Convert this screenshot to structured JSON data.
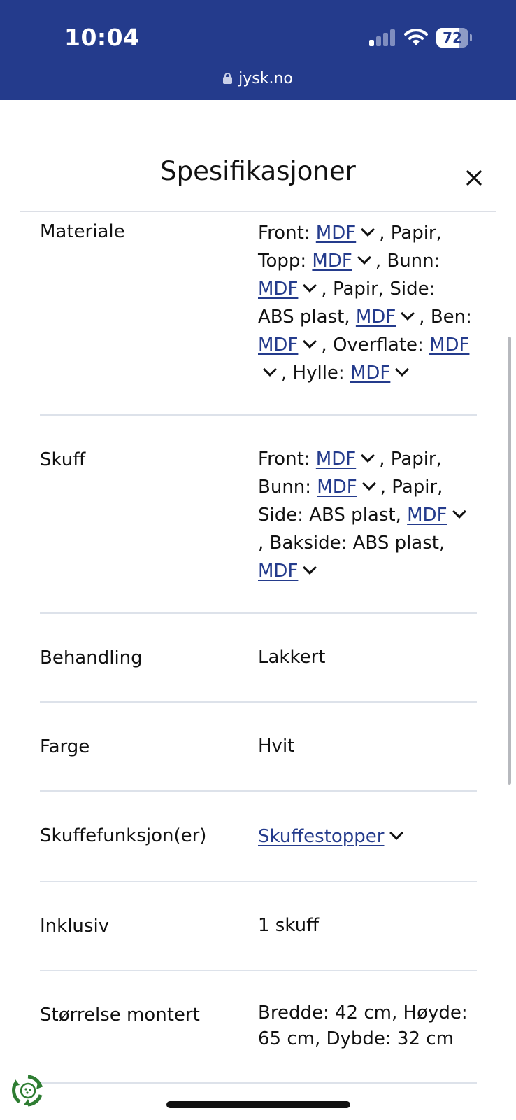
{
  "status_bar": {
    "time": "10:04",
    "battery": "72",
    "battery_level": 0.72,
    "url": "jysk.no"
  },
  "sheet": {
    "title": "Spesifikasjoner"
  },
  "rows": [
    {
      "label": "Materiale",
      "value": [
        "Front: ",
        {
          "link": "MDF"
        },
        ", Papir, Topp: ",
        {
          "link": "MDF"
        },
        ", Bunn: ",
        {
          "link": "MDF"
        },
        ", Papir, Side: ABS plast, ",
        {
          "link": "MDF"
        },
        ", Ben: ",
        {
          "link": "MDF"
        },
        ", Overflate: ",
        {
          "link": "MDF"
        },
        ", Hylle: ",
        {
          "link": "MDF"
        }
      ]
    },
    {
      "label": "Skuff",
      "value": [
        "Front: ",
        {
          "link": "MDF"
        },
        ", Papir, Bunn: ",
        {
          "link": "MDF"
        },
        ", Papir, Side: ABS plast, ",
        {
          "link": "MDF"
        },
        ", Bakside: ABS plast, ",
        {
          "link": "MDF"
        }
      ]
    },
    {
      "label": "Behandling",
      "value": [
        "Lakkert"
      ]
    },
    {
      "label": "Farge",
      "value": [
        "Hvit"
      ]
    },
    {
      "label": "Skuffefunksjon(er)",
      "value": [
        {
          "link": "Skuffestopper"
        }
      ]
    },
    {
      "label": "Inklusiv",
      "value": [
        "1 skuff"
      ]
    },
    {
      "label": "Størrelse montert",
      "value": [
        "Bredde: 42 cm, Høyde: 65 cm, Dybde: 32 cm"
      ]
    }
  ],
  "colors": {
    "brand": "#243b8c",
    "link": "#243b8c",
    "divider": "#dde2ea",
    "eco_green": "#2e7d32"
  },
  "icons": {
    "lock": "lock-icon",
    "close": "close-icon",
    "chevron": "chevron-down-icon",
    "signal": "cellular-signal-icon",
    "wifi": "wifi-icon",
    "eco": "recycle-badge-icon"
  }
}
